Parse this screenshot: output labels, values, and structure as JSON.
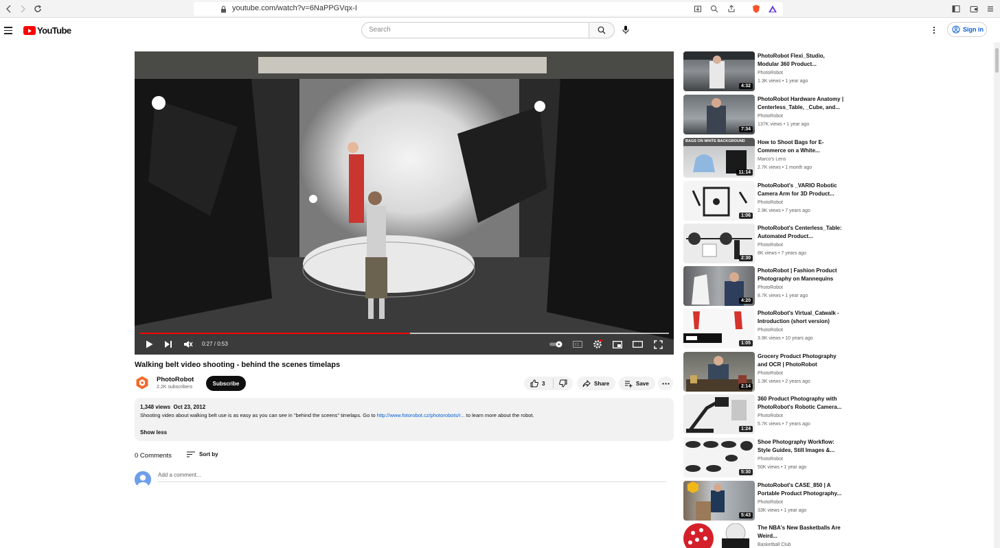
{
  "browser": {
    "url": "youtube.com/watch?v=6NaPPGVqx-I"
  },
  "header": {
    "logo_text": "YouTube",
    "search_placeholder": "Search",
    "signin_label": "Sign in"
  },
  "player": {
    "time": "0:27 / 0:53",
    "progress_fraction": 0.51,
    "loaded_fraction": 1.0
  },
  "video": {
    "title": "Walking belt video shooting - behind the scenes timelaps",
    "channel": "PhotoRobot",
    "subscribers": "2.2K subscribers",
    "subscribe_label": "Subscribe",
    "likes": "3",
    "share_label": "Share",
    "save_label": "Save",
    "views": "1,348 views",
    "date": "Oct 23, 2012",
    "description_before": "Shooting video about walking belt use is as easy as you can see in \"behind the sceens\" timelaps. Go to ",
    "description_link": "http://www.fotorobot.cz/photorobots/r...",
    "description_after": " to learn more about the robot.",
    "show_less": "Show less"
  },
  "comments": {
    "count_label": "0 Comments",
    "sort_label": "Sort by",
    "add_placeholder": "Add a comment..."
  },
  "recommendations": [
    {
      "title": "PhotoRobot Flexi_Studio, Modular 360 Product...",
      "channel": "PhotoRobot",
      "views": "1.3K views",
      "age": "1 year ago",
      "duration": "4:32"
    },
    {
      "title": "PhotoRobot Hardware Anatomy | Centerless_Table, _Cube, and...",
      "channel": "PhotoRobot",
      "views": "137K views",
      "age": "1 year ago",
      "duration": "7:34"
    },
    {
      "title": "How to Shoot Bags for E-Commerce on a White...",
      "channel": "Marco's Lens",
      "views": "2.7K views",
      "age": "1 month ago",
      "duration": "11:14",
      "thumb_caption": "BAGS ON WHITE BACKGROUND"
    },
    {
      "title": "PhotoRobot's _VARIO Robotic Camera Arm for 3D Product...",
      "channel": "PhotoRobot",
      "views": "2.9K views",
      "age": "7 years ago",
      "duration": "1:06"
    },
    {
      "title": "PhotoRobot's Centerless_Table: Automated Product...",
      "channel": "PhotoRobot",
      "views": "8K views",
      "age": "7 years ago",
      "duration": "2:30"
    },
    {
      "title": "PhotoRobot | Fashion Product Photography on Mannequins",
      "channel": "PhotoRobot",
      "views": "8.7K views",
      "age": "1 year ago",
      "duration": "4:20"
    },
    {
      "title": "PhotoRobot's Virtual_Catwalk - Introduction (short version)",
      "channel": "PhotoRobot",
      "views": "3.9K views",
      "age": "10 years ago",
      "duration": "1:05"
    },
    {
      "title": "Grocery Product Photography and OCR | PhotoRobot",
      "channel": "PhotoRobot",
      "views": "1.3K views",
      "age": "2 years ago",
      "duration": "2:14"
    },
    {
      "title": "360 Product Photography with PhotoRobot's Robotic Camera...",
      "channel": "PhotoRobot",
      "views": "5.7K views",
      "age": "7 years ago",
      "duration": "1:24"
    },
    {
      "title": "Shoe Photography Workflow: Style Guides, Still Images &...",
      "channel": "PhotoRobot",
      "views": "50K views",
      "age": "1 year ago",
      "duration": "5:30"
    },
    {
      "title": "PhotoRobot's CASE_850 | A Portable Product Photography...",
      "channel": "PhotoRobot",
      "views": "33K views",
      "age": "1 year ago",
      "duration": "5:43"
    },
    {
      "title": "The NBA's New Basketballs Are Weird...",
      "channel": "Basketball Club",
      "views": "",
      "age": "",
      "duration": ""
    }
  ],
  "colors": {
    "brand_red": "#ff0000",
    "link_blue": "#065fd4"
  }
}
